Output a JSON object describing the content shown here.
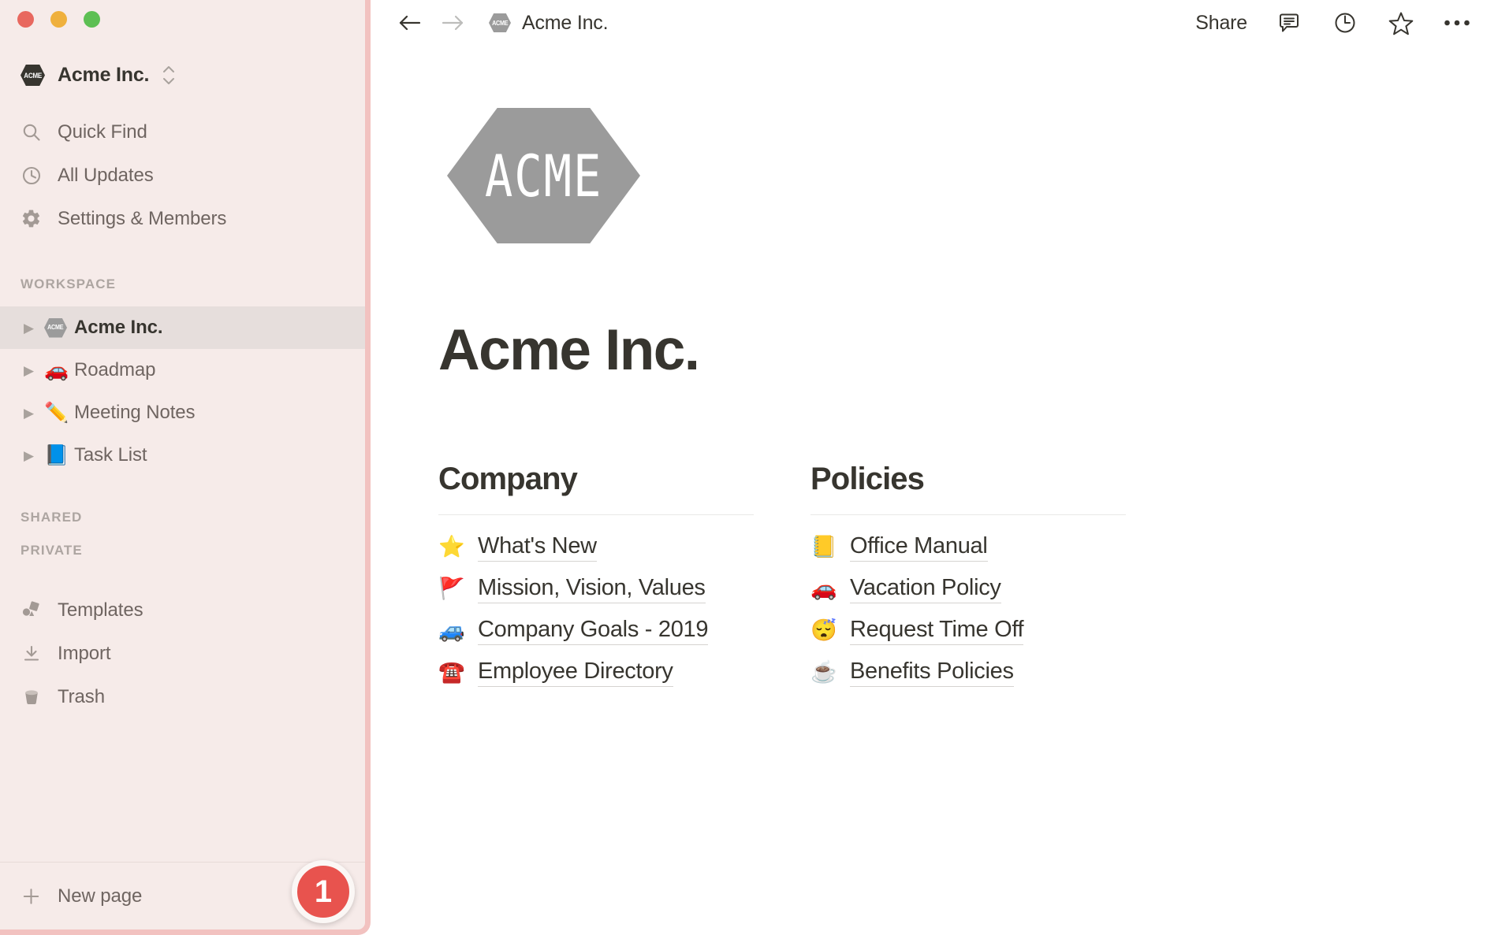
{
  "window": {
    "traffic_lights": [
      {
        "name": "close",
        "color": "#e8685f"
      },
      {
        "name": "minimize",
        "color": "#efb03d"
      },
      {
        "name": "maximize",
        "color": "#5dbf53"
      }
    ]
  },
  "sidebar": {
    "workspace_switcher": {
      "badge_text": "ACME",
      "name": "Acme Inc."
    },
    "nav": [
      {
        "icon": "search-icon",
        "label": "Quick Find"
      },
      {
        "icon": "clock-icon",
        "label": "All Updates"
      },
      {
        "icon": "gear-icon",
        "label": "Settings & Members"
      }
    ],
    "sections": {
      "workspace_label": "WORKSPACE",
      "shared_label": "SHARED",
      "private_label": "PRIVATE"
    },
    "workspace_items": [
      {
        "emoji": "ACME",
        "label": "Acme Inc.",
        "selected": true
      },
      {
        "emoji": "🚗",
        "label": "Roadmap",
        "selected": false
      },
      {
        "emoji": "✏️",
        "label": "Meeting Notes",
        "selected": false
      },
      {
        "emoji": "📘",
        "label": "Task List",
        "selected": false
      }
    ],
    "utility_items": [
      {
        "icon": "templates-icon",
        "label": "Templates"
      },
      {
        "icon": "import-icon",
        "label": "Import"
      },
      {
        "icon": "trash-icon",
        "label": "Trash"
      }
    ],
    "footer": {
      "label": "New page",
      "icon": "plus-icon"
    },
    "step_badge": "1"
  },
  "topbar": {
    "back_icon": "arrow-left-icon",
    "forward_icon": "arrow-right-icon",
    "breadcrumb": {
      "badge_text": "ACME",
      "title": "Acme Inc."
    },
    "share_label": "Share",
    "icons": [
      {
        "name": "comment-icon"
      },
      {
        "name": "clock-history-icon"
      },
      {
        "name": "star-icon"
      },
      {
        "name": "more-options-icon"
      }
    ]
  },
  "main": {
    "logo_text": "ACME",
    "title": "Acme Inc.",
    "columns": [
      {
        "heading": "Company",
        "links": [
          {
            "emoji": "⭐",
            "label": "What's New"
          },
          {
            "emoji": "🚩",
            "label": "Mission, Vision, Values"
          },
          {
            "emoji": "🚙",
            "label": "Company Goals - 2019"
          },
          {
            "emoji": "☎️",
            "label": "Employee Directory"
          }
        ]
      },
      {
        "heading": "Policies",
        "links": [
          {
            "emoji": "📒",
            "label": "Office Manual"
          },
          {
            "emoji": "🚗",
            "label": "Vacation Policy"
          },
          {
            "emoji": "😴",
            "label": "Request Time Off"
          },
          {
            "emoji": "☕",
            "label": "Benefits Policies"
          }
        ]
      }
    ]
  },
  "colors": {
    "sidebar_bg": "#f6ebe9",
    "sidebar_border": "#f2c2c0",
    "selected_row": "#e6dedc",
    "badge_red": "#e8534e",
    "logo_gray": "#9b9b9b",
    "text_dark": "#37352f",
    "text_muted": "#6f6561"
  }
}
